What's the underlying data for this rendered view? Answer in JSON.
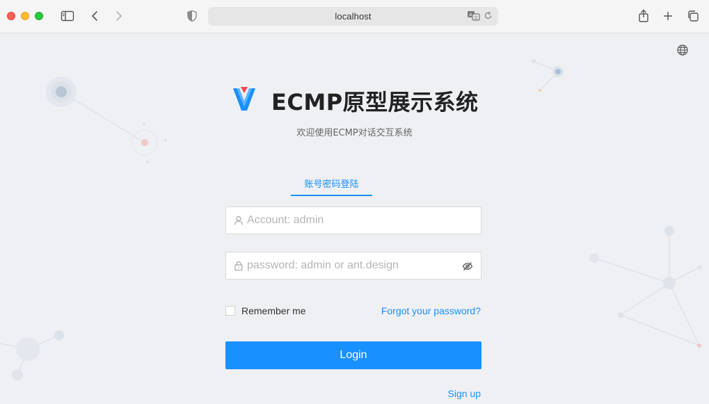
{
  "browser": {
    "url": "localhost"
  },
  "page": {
    "title": "ECMP原型展示系统",
    "subtitle": "欢迎使用ECMP对话交互系统",
    "tab_label": "账号密码登陆",
    "account_placeholder": "Account: admin",
    "password_placeholder": "password: admin or ant.design",
    "remember_label": "Remember me",
    "forgot_label": "Forgot your password?",
    "login_label": "Login",
    "signup_label": "Sign up"
  },
  "icons": {
    "sidebar": "sidebar-icon",
    "back": "chevron-left-icon",
    "forward": "chevron-right-icon",
    "shield": "shield-icon",
    "translate": "translate-icon",
    "reload": "reload-icon",
    "share": "share-icon",
    "new_tab": "plus-icon",
    "tabs": "tabs-overview-icon",
    "language": "globe-icon",
    "user": "user-icon",
    "lock": "lock-icon",
    "eye_invisible": "eye-invisible-icon"
  },
  "colors": {
    "accent": "#1890ff",
    "page_bg": "#eef0f3"
  }
}
